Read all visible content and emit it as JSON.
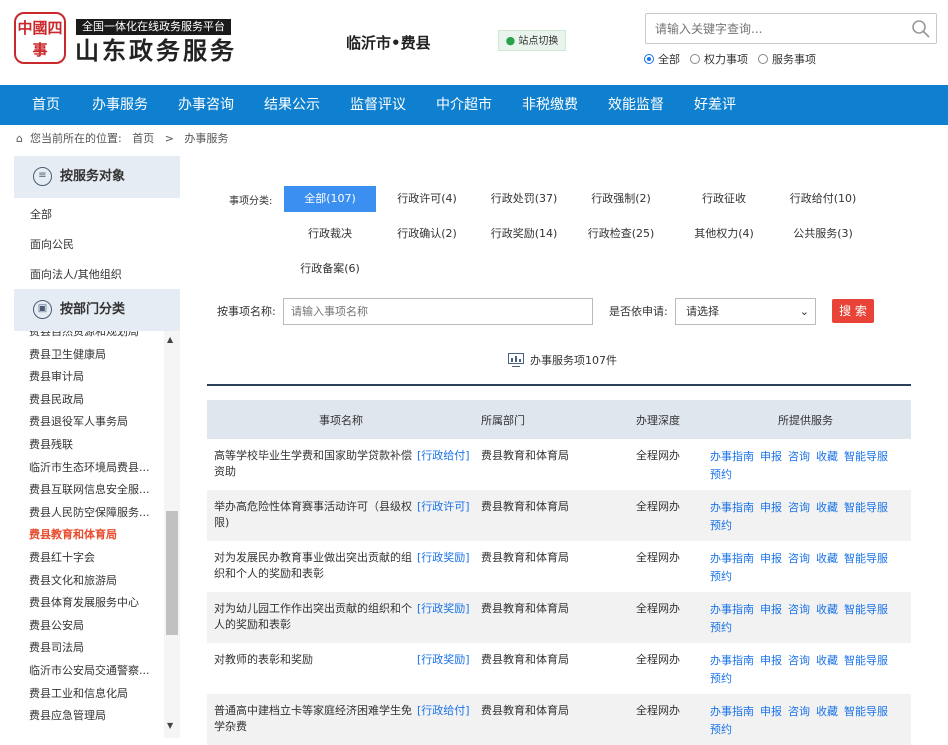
{
  "header": {
    "logo_text": "中國四事",
    "slogan": "全国一体化在线政务服务平台",
    "title": "山东政务服务",
    "region": "临沂市•费县",
    "switch_label": "站点切换",
    "search": {
      "placeholder": "请输入关键字查询...",
      "options": [
        "全部",
        "权力事项",
        "服务事项"
      ],
      "selected": "全部"
    }
  },
  "nav": {
    "items": [
      "首页",
      "办事服务",
      "办事咨询",
      "结果公示",
      "监督评议",
      "中介超市",
      "非税缴费",
      "效能监督",
      "好差评"
    ]
  },
  "breadcrumb": {
    "prefix": "您当前所在的位置:",
    "items": [
      "首页",
      ">",
      "办事服务"
    ]
  },
  "sidebar": {
    "by_target": {
      "title": "按服务对象",
      "items": [
        "全部",
        "面向公民",
        "面向法人/其他组织"
      ]
    },
    "by_dept": {
      "title": "按部门分类",
      "items": [
        "费县自然资源和规划局",
        "费县卫生健康局",
        "费县审计局",
        "费县民政局",
        "费县退役军人事务局",
        "费县残联",
        "临沂市生态环境局费县...",
        "费县互联网信息安全服...",
        "费县人民防空保障服务...",
        "费县教育和体育局",
        "费县红十字会",
        "费县文化和旅游局",
        "费县体育发展服务中心",
        "费县公安局",
        "费县司法局",
        "临沂市公安局交通警察...",
        "费县工业和信息化局",
        "费县应急管理局"
      ],
      "selected": "费县教育和体育局"
    }
  },
  "filter": {
    "category_label": "事项分类:",
    "categories": [
      "全部(107)",
      "行政许可(4)",
      "行政处罚(37)",
      "行政强制(2)",
      "行政征收",
      "行政给付(10)",
      "行政裁决",
      "行政确认(2)",
      "行政奖励(14)",
      "行政检查(25)",
      "其他权力(4)",
      "公共服务(3)",
      "行政备案(6)"
    ],
    "active_category": "全部(107)",
    "name_label": "按事项名称:",
    "name_placeholder": "请输入事项名称",
    "apply_label": "是否依申请:",
    "apply_value": "请选择",
    "search_button": "搜 索"
  },
  "summary": {
    "count_text": "办事服务项107件"
  },
  "table": {
    "headers": [
      "事项名称",
      "所属部门",
      "办理深度",
      "所提供服务"
    ],
    "services": [
      "办事指南",
      "申报",
      "咨询",
      "收藏",
      "智能导服",
      "预约"
    ],
    "rows": [
      {
        "name": "高等学校毕业生学费和国家助学贷款补偿资助",
        "tag": "[行政给付]",
        "dept": "费县教育和体育局",
        "depth": "全程网办"
      },
      {
        "name": "举办高危险性体育赛事活动许可（县级权限)",
        "tag": "[行政许可]",
        "dept": "费县教育和体育局",
        "depth": "全程网办"
      },
      {
        "name": "对为发展民办教育事业做出突出贡献的组织和个人的奖励和表彰",
        "tag": "[行政奖励]",
        "dept": "费县教育和体育局",
        "depth": "全程网办"
      },
      {
        "name": "对为幼儿园工作作出突出贡献的组织和个人的奖励和表彰",
        "tag": "[行政奖励]",
        "dept": "费县教育和体育局",
        "depth": "全程网办"
      },
      {
        "name": "对教师的表彰和奖励",
        "tag": "[行政奖励]",
        "dept": "费县教育和体育局",
        "depth": "全程网办"
      },
      {
        "name": "普通高中建档立卡等家庭经济困难学生免学杂费",
        "tag": "[行政给付]",
        "dept": "费县教育和体育局",
        "depth": "全程网办"
      }
    ]
  },
  "colors": {
    "nav_bg": "#0f80cf",
    "accent_blue": "#3b8ff0",
    "search_red": "#e94236",
    "selected_dept": "#e84a2b",
    "seal_red": "#c9282d"
  }
}
